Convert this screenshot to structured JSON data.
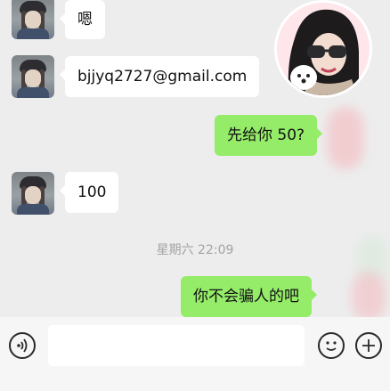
{
  "messages": [
    {
      "side": "in",
      "text": "嗯"
    },
    {
      "side": "in",
      "text": "bjjyq2727@gmail.com"
    },
    {
      "side": "out",
      "text": "先给你 50?"
    },
    {
      "side": "in",
      "text": "100"
    },
    {
      "side": "out",
      "text": "你不会骗人的吧"
    }
  ],
  "timestamp": "星期六 22:09",
  "input_bar": {
    "voice_icon": "voice-icon",
    "emoji_icon": "emoji-icon",
    "add_icon": "add-icon"
  },
  "colors": {
    "background": "#ededed",
    "incoming_bubble": "#ffffff",
    "outgoing_bubble": "#95ec69"
  }
}
